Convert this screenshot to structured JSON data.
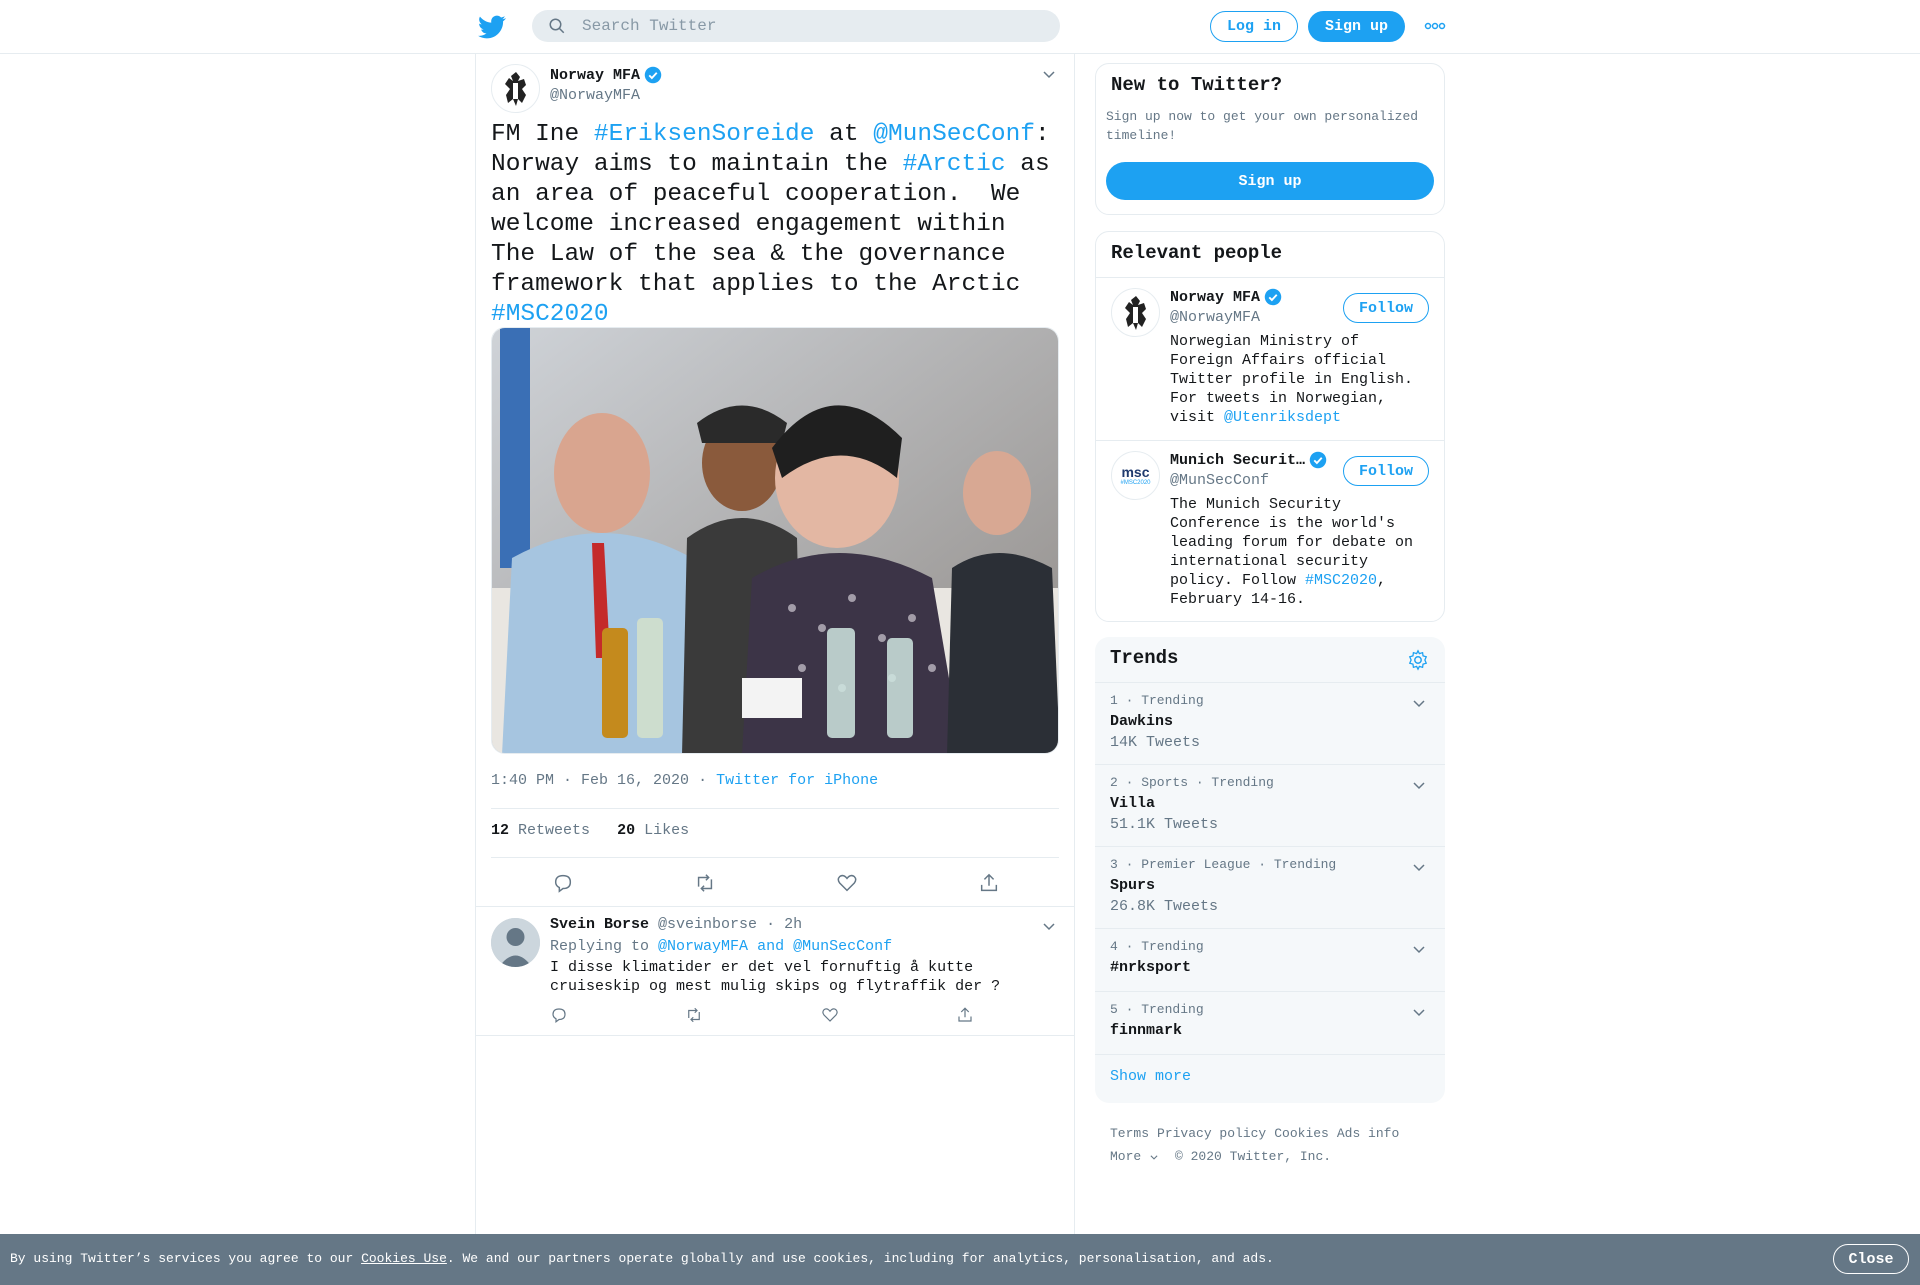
{
  "header": {
    "search_placeholder": "Search Twitter",
    "login_label": "Log in",
    "signup_label": "Sign up"
  },
  "tweet": {
    "author_name": "Norway MFA",
    "author_handle": "@NorwayMFA",
    "text_segments": [
      {
        "t": "FM Ine ",
        "link": false
      },
      {
        "t": "#EriksenSoreide",
        "link": true
      },
      {
        "t": " at ",
        "link": false
      },
      {
        "t": "@MunSecConf",
        "link": true
      },
      {
        "t": ": Norway aims to maintain the ",
        "link": false
      },
      {
        "t": "#Arctic",
        "link": true
      },
      {
        "t": " as an area of peaceful cooperation.  We welcome increased engagement within The Law of the sea & the governance framework that applies to the Arctic ",
        "link": false
      },
      {
        "t": "#MSC2020",
        "link": true
      }
    ],
    "timestamp": "1:40 PM · Feb 16, 2020",
    "source": "Twitter for iPhone",
    "retweets_count": "12",
    "retweets_label": "Retweets",
    "likes_count": "20",
    "likes_label": "Likes"
  },
  "reply": {
    "name": "Svein Borse",
    "handle_time": "@sveinborse · 2h",
    "replying_prefix": "Replying to",
    "replying_to": "@NorwayMFA and @MunSecConf",
    "text": "I disse klimatider er det vel fornuftig å kutte cruiseskip og mest mulig skips og flytraffik der ?"
  },
  "new_to_twitter": {
    "title": "New to Twitter?",
    "subtitle": "Sign up now to get your own personalized timeline!",
    "button": "Sign up"
  },
  "relevant_people": {
    "title": "Relevant people",
    "people": [
      {
        "name": "Norway MFA",
        "handle": "@NorwayMFA",
        "bio": "Norwegian Ministry of Foreign Affairs official Twitter profile in English. For tweets in Norwegian, visit ",
        "bio_link": "@Utenriksdept",
        "bio_after": "",
        "follow": "Follow"
      },
      {
        "name": "Munich Securit…",
        "handle": "@MunSecConf",
        "bio": "The Munich Security Conference is the world's leading forum for debate on international security policy. Follow ",
        "bio_link": "#MSC2020",
        "bio_after": ", February 14-16.",
        "follow": "Follow",
        "logo_text": "msc",
        "logo_sub": "#MSC2020"
      }
    ]
  },
  "trends": {
    "title": "Trends",
    "items": [
      {
        "context": "1 · Trending",
        "name": "Dawkins",
        "count": "14K Tweets"
      },
      {
        "context": "2 · Sports · Trending",
        "name": "Villa",
        "count": "51.1K Tweets"
      },
      {
        "context": "3 · Premier League · Trending",
        "name": "Spurs",
        "count": "26.8K Tweets"
      },
      {
        "context": "4 · Trending",
        "name": "#nrksport",
        "count": ""
      },
      {
        "context": "5 · Trending",
        "name": "finnmark",
        "count": ""
      }
    ],
    "show_more": "Show more"
  },
  "footer": {
    "links": [
      "Terms",
      "Privacy policy",
      "Cookies",
      "Ads info"
    ],
    "more": "More",
    "copyright": "© 2020 Twitter, Inc."
  },
  "cookie": {
    "prefix": "By using Twitter’s services you agree to our ",
    "link": "Cookies Use",
    "suffix": ". We and our partners operate globally and use cookies, including for analytics, personalisation, and ads.",
    "close": "Close"
  },
  "colors": {
    "accent": "#1da1f2",
    "secondary_text": "#657786",
    "cookie_bar": "#657786"
  }
}
